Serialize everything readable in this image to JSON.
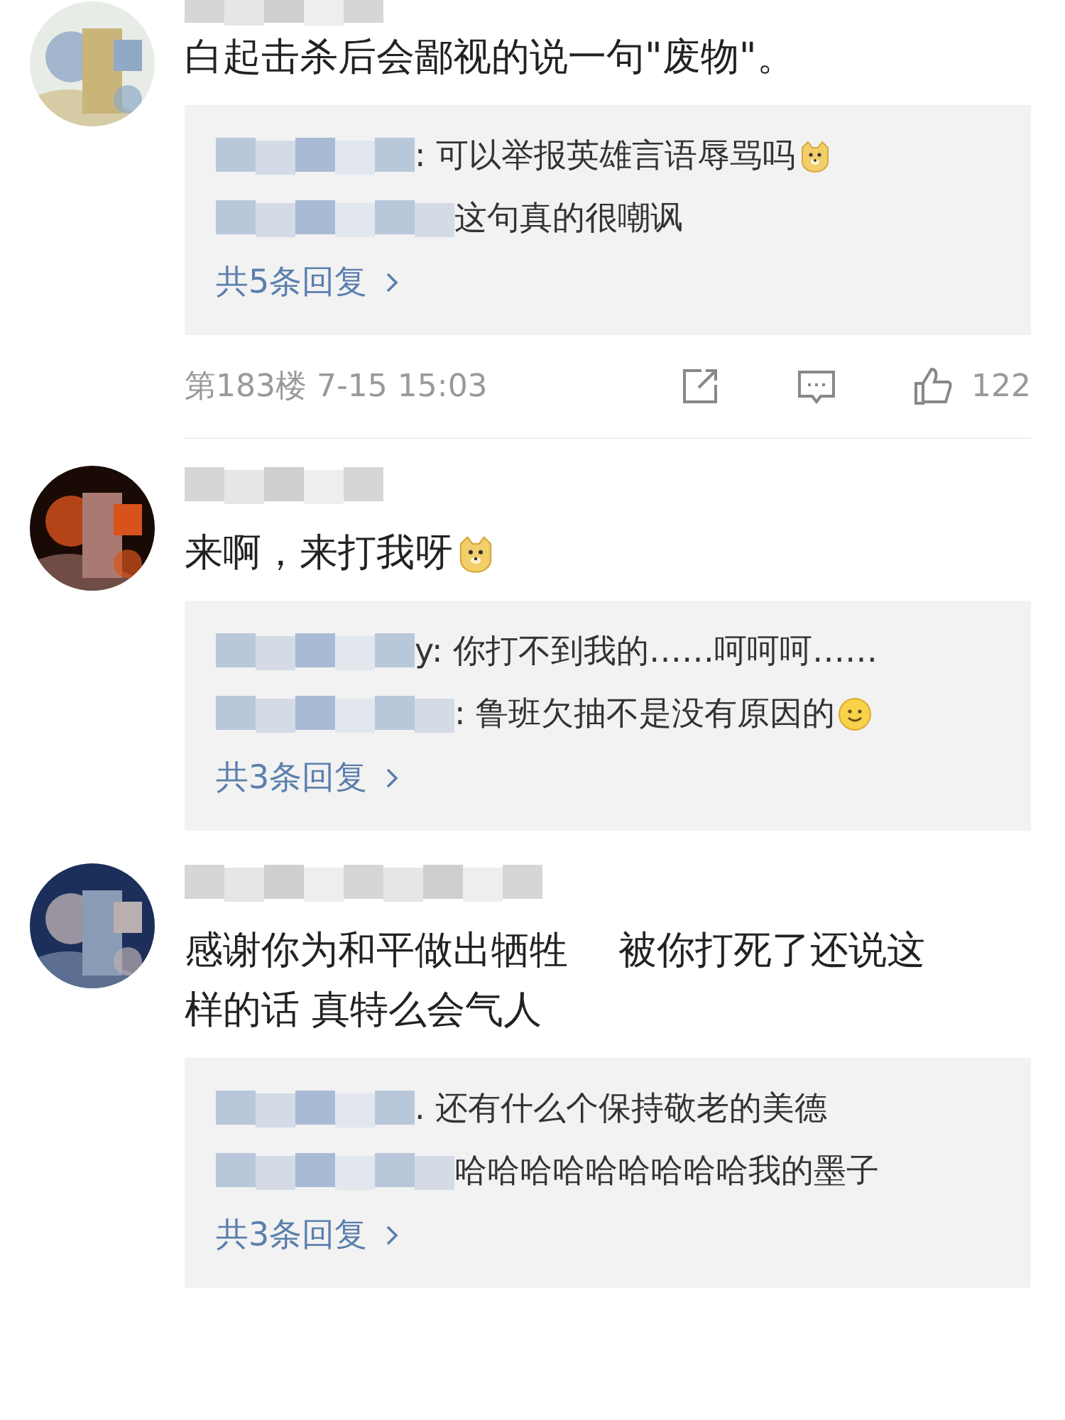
{
  "comments": [
    {
      "avatar": {
        "kind": "picture"
      },
      "text": "白起击杀后会鄙视的说一句\"废物\"。",
      "replies": [
        {
          "text": ": 可以举报英雄言语辱骂吗",
          "emoji": {
            "kind": "doge"
          }
        },
        {
          "text": "这句真的很嘲讽"
        }
      ],
      "more_replies": "共5条回复",
      "footer": {
        "floor": "第183楼 7-15 15:03",
        "likes": "122"
      }
    },
    {
      "avatar": {
        "kind": "picture"
      },
      "text": "来啊，来打我呀",
      "emoji": {
        "kind": "doge"
      },
      "replies": [
        {
          "text": "y: 你打不到我的……呵呵呵……"
        },
        {
          "text": ": 鲁班欠抽不是没有原因的",
          "emoji": {
            "kind": "smile"
          }
        }
      ],
      "more_replies": "共3条回复"
    },
    {
      "avatar": {
        "kind": "picture"
      },
      "text": "感谢你为和平做出牺牲　 被你打死了还说这样的话 真特么会气人",
      "replies": [
        {
          "text": ". 还有什么个保持敬老的美德"
        },
        {
          "text": "哈哈哈哈哈哈哈哈哈我的墨子"
        }
      ],
      "more_replies": "共3条回复"
    }
  ]
}
